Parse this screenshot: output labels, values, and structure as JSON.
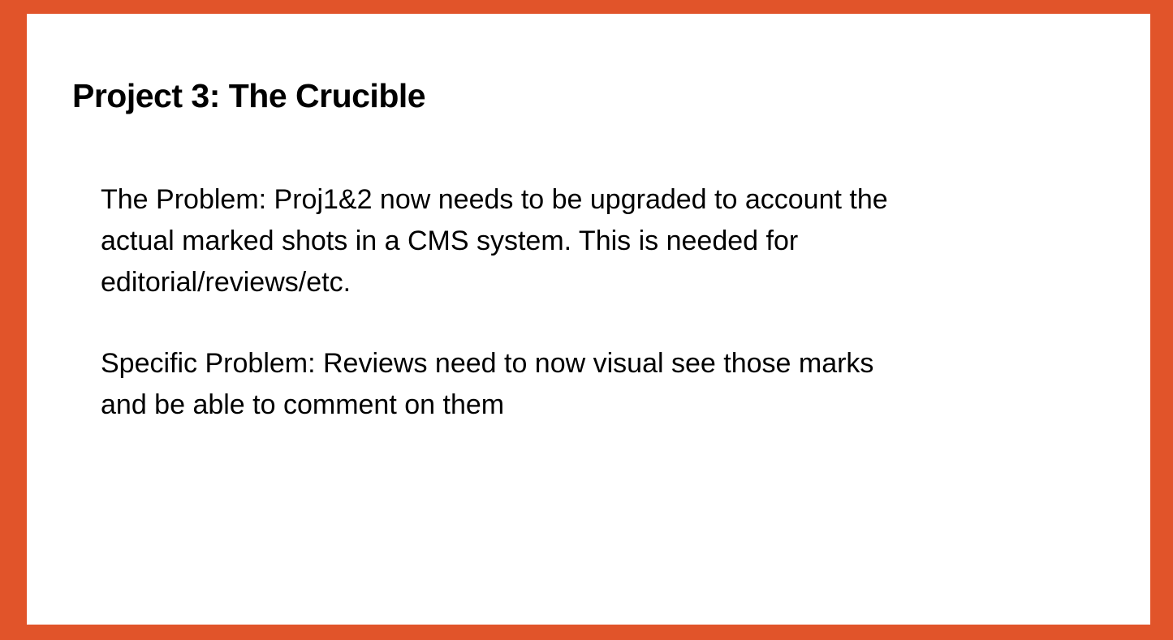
{
  "slide": {
    "title": "Project 3: The Crucible",
    "paragraphs": [
      "The Problem: Proj1&2 now needs to be upgraded to account the actual marked shots in a CMS system. This is needed for editorial/reviews/etc.",
      "Specific Problem: Reviews need to now visual see those marks and be able to comment on them"
    ]
  },
  "colors": {
    "frame": "#e1542a",
    "background": "#ffffff",
    "text": "#000000"
  }
}
